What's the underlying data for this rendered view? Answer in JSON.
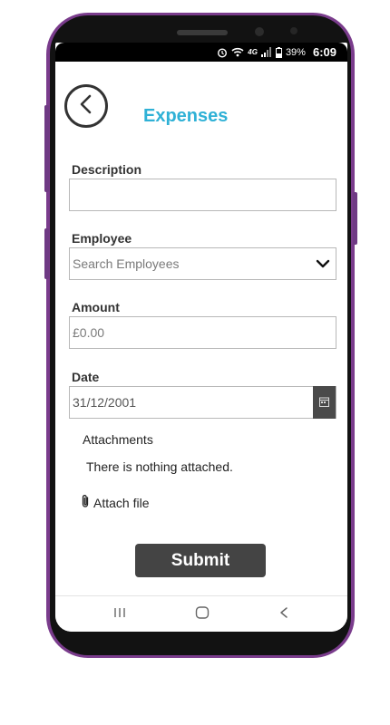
{
  "status_bar": {
    "network_label": "4G",
    "battery_percent": "39%",
    "time": "6:09"
  },
  "header": {
    "title": "Expenses",
    "back_icon": "chevron-left-icon"
  },
  "form": {
    "description": {
      "label": "Description",
      "value": ""
    },
    "employee": {
      "label": "Employee",
      "placeholder": "Search Employees",
      "icon": "chevron-down-icon"
    },
    "amount": {
      "label": "Amount",
      "placeholder": "£0.00"
    },
    "date": {
      "label": "Date",
      "value": "31/12/2001",
      "icon": "calendar-icon"
    }
  },
  "attachments": {
    "title": "Attachments",
    "empty_text": "There is nothing attached.",
    "attach_label": "Attach file",
    "attach_icon": "paperclip-icon"
  },
  "submit": {
    "label": "Submit"
  },
  "nav": {
    "items": [
      "recent-apps-icon",
      "home-icon",
      "back-icon"
    ]
  },
  "colors": {
    "title": "#2fb1d6",
    "submit_bg": "#444444",
    "phone_frame": "#7a3c8c"
  }
}
